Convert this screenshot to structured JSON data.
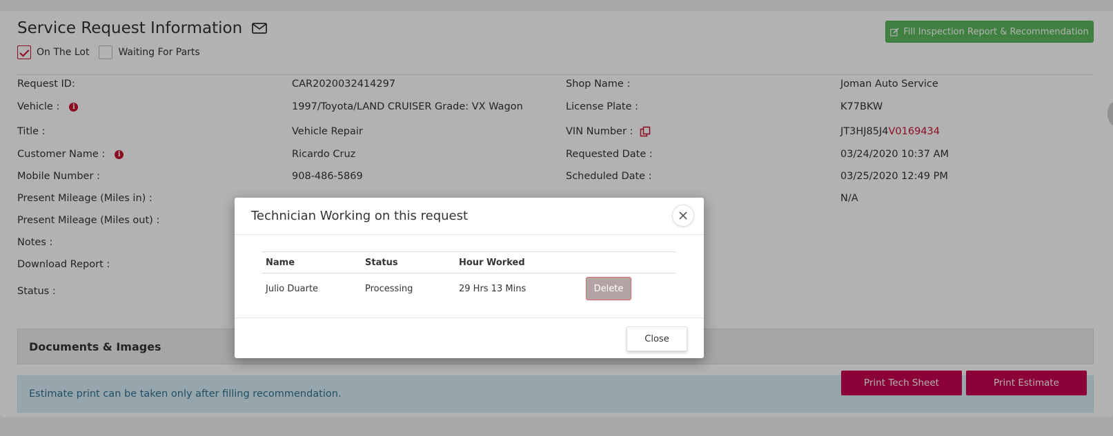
{
  "header": {
    "title": "Service Request Information",
    "fill_button": "Fill Inspection Report & Recommendation"
  },
  "checkboxes": [
    {
      "label": "On The Lot",
      "checked": true
    },
    {
      "label": "Waiting For Parts",
      "checked": false
    }
  ],
  "details_left": [
    {
      "label": "Request ID:",
      "value": "CAR2020032414297"
    },
    {
      "label": "Vehicle :",
      "value": "1997/Toyota/LAND CRUISER Grade: VX Wagon",
      "icon": "info-icon"
    },
    {
      "label": "Title :",
      "value": "Vehicle Repair"
    },
    {
      "label": "Customer Name :",
      "value": "Ricardo Cruz",
      "icon": "info-icon"
    },
    {
      "label": "Mobile Number :",
      "value": "908-486-5869"
    },
    {
      "label": "Present Mileage (Miles in) :",
      "value": ""
    },
    {
      "label": "Present Mileage (Miles out) :",
      "value": ""
    },
    {
      "label": "Notes :",
      "value": ""
    },
    {
      "label": "Download Report :",
      "value": ""
    },
    {
      "label": "Status :",
      "value": ""
    }
  ],
  "details_right": [
    {
      "label": "Shop Name :",
      "value": "Joman Auto Service"
    },
    {
      "label": "License Plate :",
      "value": "K77BKW"
    },
    {
      "label": "VIN Number :",
      "value_prefix": "JT3HJ85J4",
      "value_highlight": "V0169434",
      "icon": "copy-icon"
    },
    {
      "label": "Requested Date :",
      "value": "03/24/2020 10:37 AM"
    },
    {
      "label": "Scheduled Date :",
      "value": "03/25/2020 12:49 PM"
    },
    {
      "label": "",
      "value": "N/A"
    }
  ],
  "documents": {
    "title": "Documents & Images"
  },
  "notice": {
    "text": "Estimate print can be taken only after filling recommendation."
  },
  "print_buttons": {
    "tech_sheet": "Print Tech Sheet",
    "estimate": "Print Estimate"
  },
  "modal": {
    "title": "Technician Working on this request",
    "columns": [
      "Name",
      "Status",
      "Hour Worked"
    ],
    "rows": [
      {
        "name": "Julio Duarte",
        "status": "Processing",
        "hours": "29 Hrs 13 Mins",
        "action": "Delete"
      }
    ],
    "close_label": "Close"
  },
  "colors": {
    "accent": "#c8004e",
    "success": "#5cb85c",
    "info_bg": "#d9edf7",
    "info_text": "#31708f"
  }
}
